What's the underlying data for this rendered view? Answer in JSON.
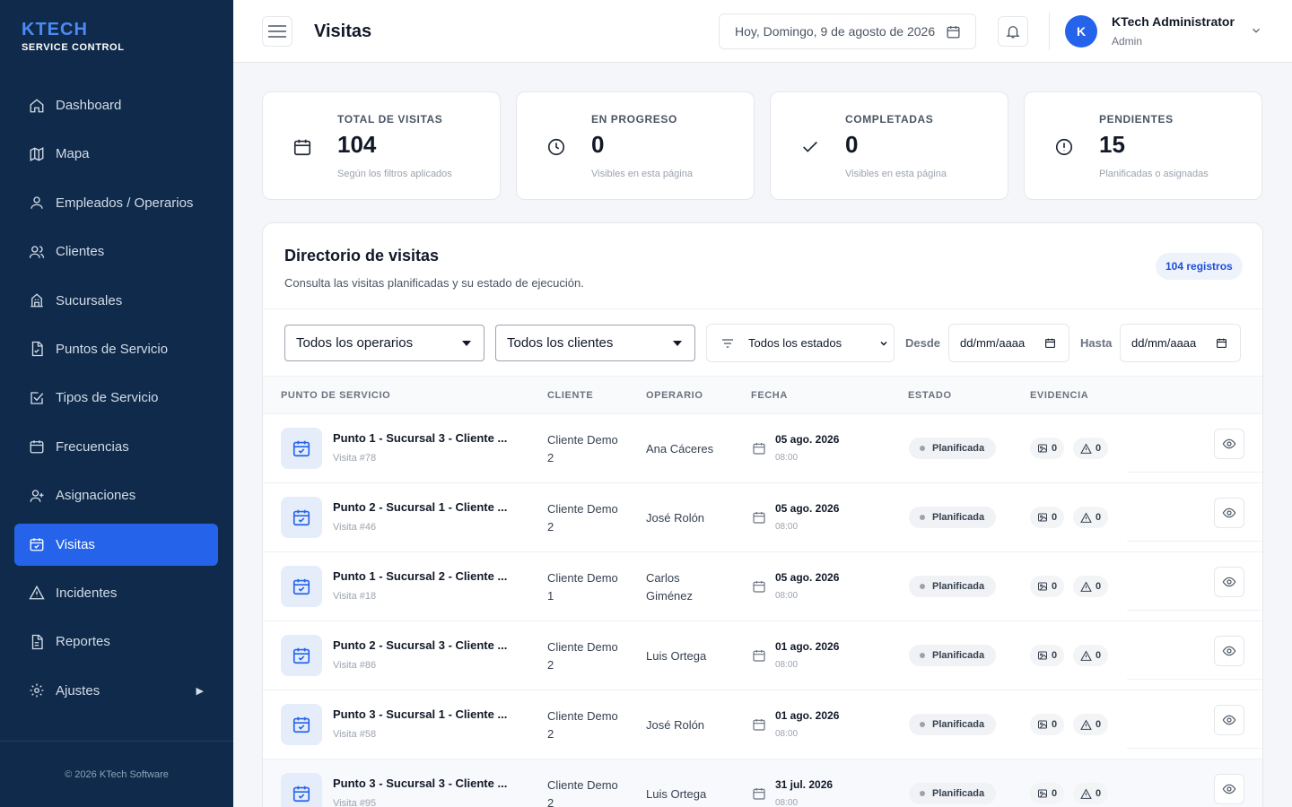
{
  "brand": {
    "title": "KTECH",
    "subtitle": "SERVICE CONTROL"
  },
  "sidebar": {
    "items": [
      {
        "label": "Dashboard",
        "icon": "home-icon"
      },
      {
        "label": "Mapa",
        "icon": "map-icon"
      },
      {
        "label": "Empleados / Operarios",
        "icon": "user-icon"
      },
      {
        "label": "Clientes",
        "icon": "users-icon"
      },
      {
        "label": "Sucursales",
        "icon": "building-icon"
      },
      {
        "label": "Puntos de Servicio",
        "icon": "file-check-icon"
      },
      {
        "label": "Tipos de Servicio",
        "icon": "checkbox-icon"
      },
      {
        "label": "Frecuencias",
        "icon": "calendar-icon"
      },
      {
        "label": "Asignaciones",
        "icon": "user-plus-icon"
      },
      {
        "label": "Visitas",
        "icon": "calendar-check-icon",
        "active": true
      },
      {
        "label": "Incidentes",
        "icon": "warning-icon"
      },
      {
        "label": "Reportes",
        "icon": "document-icon"
      },
      {
        "label": "Ajustes",
        "icon": "gear-icon",
        "submenu": true
      }
    ],
    "footer": "© 2026 KTech Software"
  },
  "header": {
    "title": "Visitas",
    "date": "Hoy, Domingo, 9 de agosto de 2026",
    "user": {
      "initial": "K",
      "name": "KTech Administrator",
      "role": "Admin"
    }
  },
  "stats": [
    {
      "label": "TOTAL DE VISITAS",
      "value": "104",
      "note": "Según los filtros aplicados",
      "icon": "calendar-icon"
    },
    {
      "label": "EN PROGRESO",
      "value": "0",
      "note": "Visibles en esta página",
      "icon": "clock-icon"
    },
    {
      "label": "COMPLETADAS",
      "value": "0",
      "note": "Visibles en esta página",
      "icon": "check-icon"
    },
    {
      "label": "PENDIENTES",
      "value": "15",
      "note": "Planificadas o asignadas",
      "icon": "alert-circle-icon"
    }
  ],
  "directory": {
    "title": "Directorio de visitas",
    "subtitle": "Consulta las visitas planificadas y su estado de ejecución.",
    "count_badge": "104 registros",
    "filters": {
      "operarios": "Todos los operarios",
      "clientes": "Todos los clientes",
      "estados": "Todos los estados",
      "desde_label": "Desde",
      "desde_placeholder": "dd/mm/aaaa",
      "hasta_label": "Hasta",
      "hasta_placeholder": "dd/mm/aaaa"
    },
    "columns": [
      "PUNTO DE SERVICIO",
      "CLIENTE",
      "OPERARIO",
      "FECHA",
      "ESTADO",
      "EVIDENCIA"
    ],
    "rows": [
      {
        "point": "Punto 1 - Sucursal 3 - Cliente ...",
        "visit": "Visita #78",
        "client": "Cliente Demo 2",
        "operator": "Ana Cáceres",
        "date": "05 ago. 2026",
        "time": "08:00",
        "status": "Planificada",
        "photos": "0",
        "incidents": "0"
      },
      {
        "point": "Punto 2 - Sucursal 1 - Cliente ...",
        "visit": "Visita #46",
        "client": "Cliente Demo 2",
        "operator": "José Rolón",
        "date": "05 ago. 2026",
        "time": "08:00",
        "status": "Planificada",
        "photos": "0",
        "incidents": "0"
      },
      {
        "point": "Punto 1 - Sucursal 2 - Cliente ...",
        "visit": "Visita #18",
        "client": "Cliente Demo 1",
        "operator": "Carlos Giménez",
        "date": "05 ago. 2026",
        "time": "08:00",
        "status": "Planificada",
        "photos": "0",
        "incidents": "0"
      },
      {
        "point": "Punto 2 - Sucursal 3 - Cliente ...",
        "visit": "Visita #86",
        "client": "Cliente Demo 2",
        "operator": "Luis Ortega",
        "date": "01 ago. 2026",
        "time": "08:00",
        "status": "Planificada",
        "photos": "0",
        "incidents": "0"
      },
      {
        "point": "Punto 3 - Sucursal 1 - Cliente ...",
        "visit": "Visita #58",
        "client": "Cliente Demo 2",
        "operator": "José Rolón",
        "date": "01 ago. 2026",
        "time": "08:00",
        "status": "Planificada",
        "photos": "0",
        "incidents": "0"
      },
      {
        "point": "Punto 3 - Sucursal 3 - Cliente ...",
        "visit": "Visita #95",
        "client": "Cliente Demo 2",
        "operator": "Luis Ortega",
        "date": "31 jul. 2026",
        "time": "08:00",
        "status": "Planificada",
        "photos": "0",
        "incidents": "0"
      }
    ]
  },
  "colors": {
    "sidebar": "#0f2a4a",
    "accent": "#2563eb",
    "brand": "#4c8bf5"
  }
}
